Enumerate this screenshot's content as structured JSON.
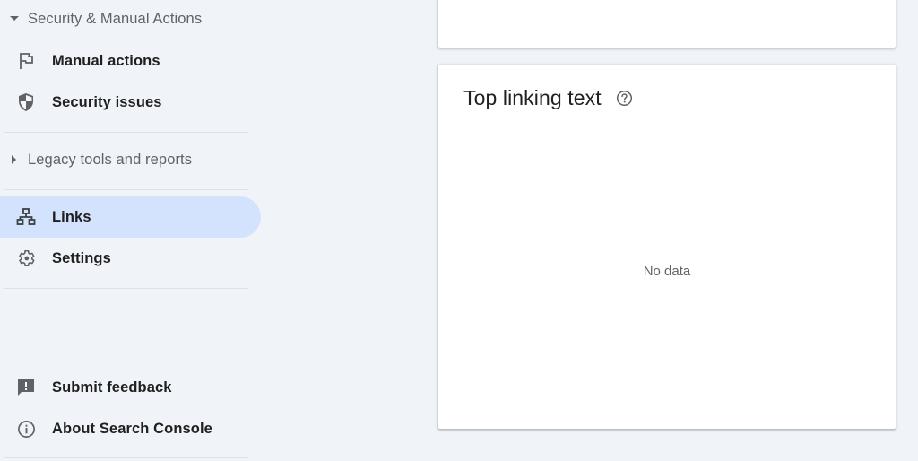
{
  "sidebar": {
    "sections": [
      {
        "label": "Security & Manual Actions",
        "expanded": true,
        "icon": "caret-down-icon"
      },
      {
        "label": "Legacy tools and reports",
        "expanded": false,
        "icon": "caret-right-icon"
      }
    ],
    "items": [
      {
        "label": "Manual actions",
        "icon": "flag-icon"
      },
      {
        "label": "Security issues",
        "icon": "shield-icon"
      },
      {
        "label": "Links",
        "icon": "sitemap-icon",
        "active": true
      },
      {
        "label": "Settings",
        "icon": "gear-icon"
      },
      {
        "label": "Submit feedback",
        "icon": "feedback-icon"
      },
      {
        "label": "About Search Console",
        "icon": "info-icon"
      }
    ]
  },
  "main": {
    "card": {
      "title": "Top linking text",
      "help_icon": "help-circle-icon",
      "empty_text": "No data"
    }
  },
  "colors": {
    "background": "#f0f4f9",
    "active_item": "#d3e3fd",
    "card": "#ffffff",
    "muted_text": "#5f6368"
  }
}
